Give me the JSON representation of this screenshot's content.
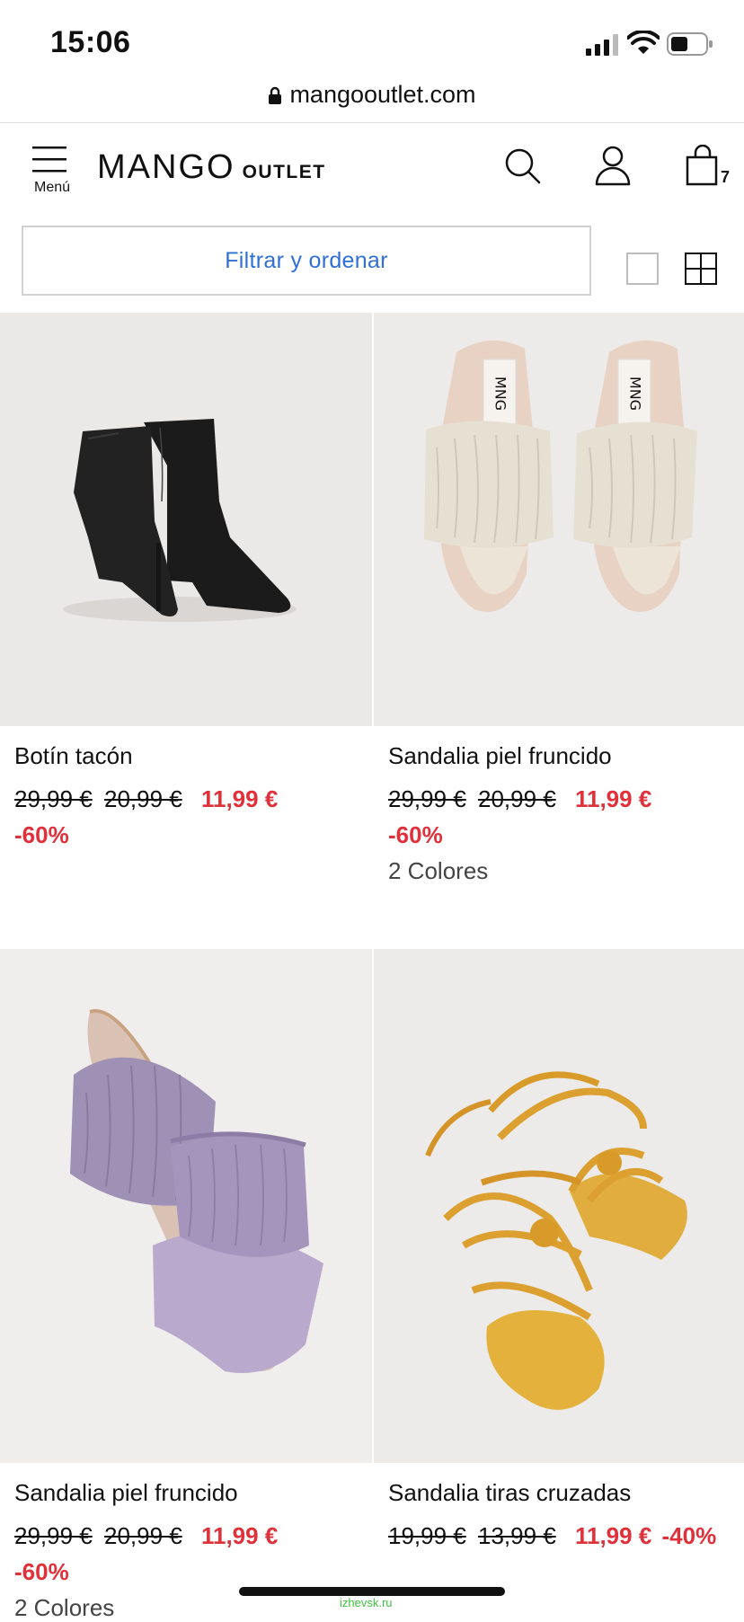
{
  "status_bar": {
    "time": "15:06"
  },
  "browser": {
    "url": "mangooutlet.com"
  },
  "header": {
    "menu_label": "Menú",
    "logo_main": "MANGO",
    "logo_sub": "OUTLET",
    "cart_count": "7"
  },
  "filter": {
    "label": "Filtrar y ordenar"
  },
  "products": [
    {
      "name": "Botín tacón",
      "price_original": "29,99 €",
      "price_previous": "20,99 €",
      "price_sale": "11,99 €",
      "discount": "-60%",
      "colors": ""
    },
    {
      "name": "Sandalia piel fruncido",
      "price_original": "29,99 €",
      "price_previous": "20,99 €",
      "price_sale": "11,99 €",
      "discount": "-60%",
      "colors": "2 Colores"
    },
    {
      "name": "Sandalia piel fruncido",
      "price_original": "29,99 €",
      "price_previous": "20,99 €",
      "price_sale": "11,99 €",
      "discount": "-60%",
      "colors": "2 Colores"
    },
    {
      "name": "Sandalia tiras cruzadas",
      "price_original": "19,99 €",
      "price_previous": "13,99 €",
      "price_sale": "11,99 €",
      "discount": "-40%",
      "colors": ""
    }
  ],
  "watermark": "izhevsk.ru",
  "colors": {
    "accent_blue": "#2f6fd6",
    "sale_red": "#e0313b",
    "image_bg": "#eceae8"
  }
}
